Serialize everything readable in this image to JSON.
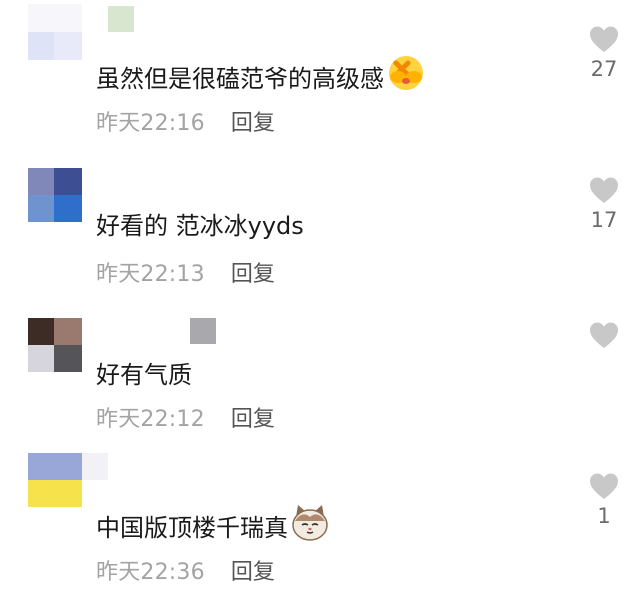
{
  "comments": [
    {
      "text": "虽然但是很磕范爷的高级感",
      "emoji": "face-covering-emoji",
      "time": "昨天22:16",
      "reply": "回复",
      "likes": "27"
    },
    {
      "text": "好看的 范冰冰yyds",
      "time": "昨天22:13",
      "reply": "回复",
      "likes": "17"
    },
    {
      "text": "好有气质",
      "time": "昨天22:12",
      "reply": "回复",
      "likes": ""
    },
    {
      "text": "中国版顶楼千瑞真",
      "emoji": "cat-emoji",
      "time": "昨天22:36",
      "reply": "回复",
      "likes": "1"
    }
  ],
  "colors": {
    "text": "#1a1a1a",
    "muted": "#a3a3a3",
    "heart": "#c8c8c8"
  }
}
